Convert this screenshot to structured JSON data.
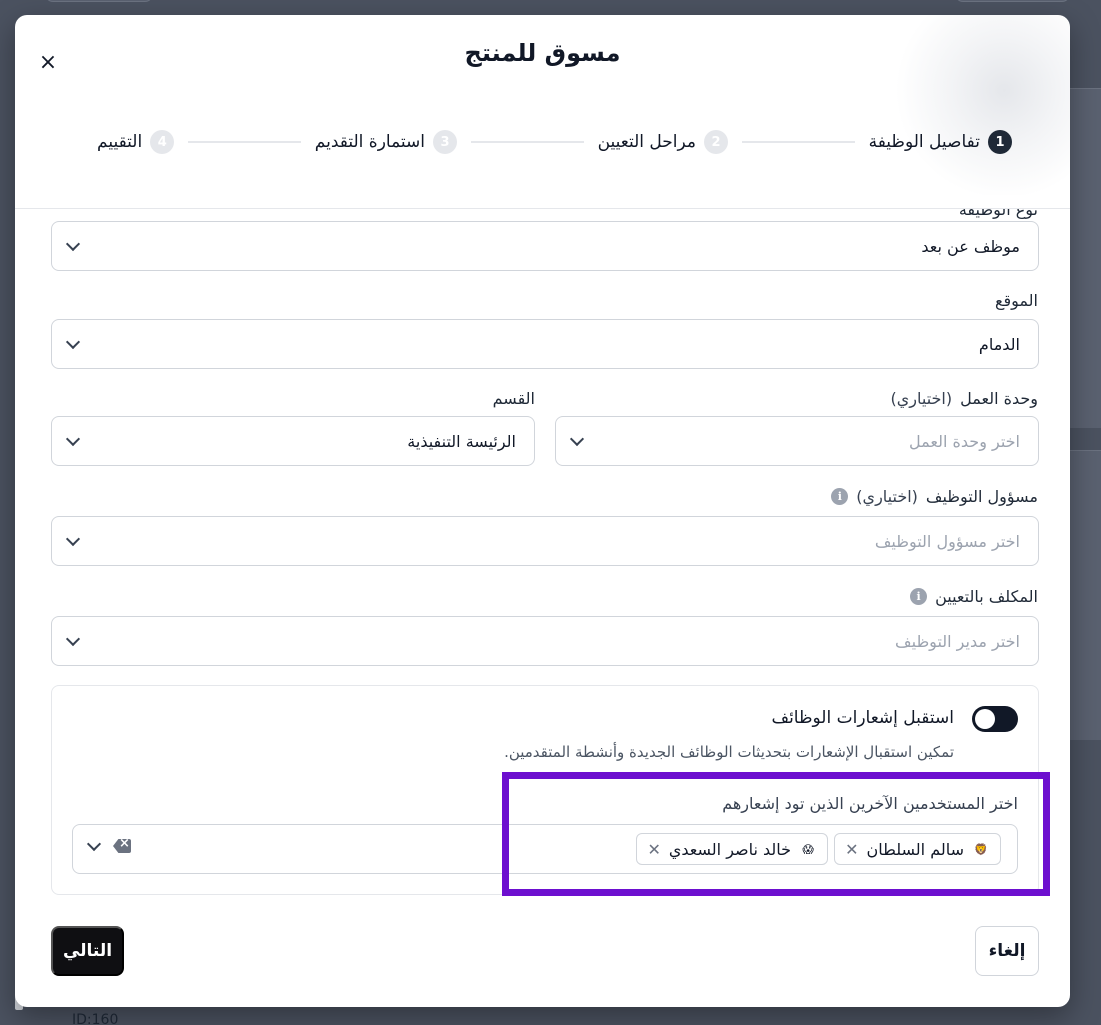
{
  "background": {
    "id_text": "ID:160"
  },
  "modal": {
    "title": "مسوق للمنتج",
    "close_icon": "×"
  },
  "stepper": [
    {
      "num": "1",
      "label": "تفاصيل الوظيفة",
      "active": true
    },
    {
      "num": "2",
      "label": "مراحل التعيين",
      "active": false
    },
    {
      "num": "3",
      "label": "استمارة التقديم",
      "active": false
    },
    {
      "num": "4",
      "label": "التقييم",
      "active": false
    }
  ],
  "form": {
    "job_type": {
      "label": "نوع الوظيفة",
      "value": "موظف عن بعد"
    },
    "location": {
      "label": "الموقع",
      "value": "الدمام"
    },
    "work_unit": {
      "label": "وحدة العمل",
      "optional": "(اختياري)",
      "placeholder": "اختر وحدة العمل"
    },
    "department": {
      "label": "القسم",
      "value": "الرئيسة التنفيذية"
    },
    "recruiter": {
      "label": "مسؤول التوظيف",
      "optional": "(اختياري)",
      "placeholder": "اختر مسؤول التوظيف"
    },
    "assignee": {
      "label": "المكلف بالتعيين",
      "placeholder": "اختر مدير التوظيف"
    }
  },
  "notifications": {
    "toggle_label": "استقبل إشعارات الوظائف",
    "toggle_on": true,
    "description": "تمكين استقبال الإشعارات بتحديثات الوظائف الجديدة وأنشطة المتقدمين.",
    "users_label": "اختر المستخدمين الآخرين الذين تود إشعارهم",
    "selected_users": [
      {
        "name": "سالم السلطان",
        "avatar": "🦁"
      },
      {
        "name": "خالد ناصر السعدي",
        "avatar": "😱"
      }
    ]
  },
  "footer": {
    "cancel_label": "إلغاء",
    "next_label": "التالي"
  },
  "colors": {
    "highlight": "#6d0fcf",
    "primary": "#0f0f12"
  }
}
